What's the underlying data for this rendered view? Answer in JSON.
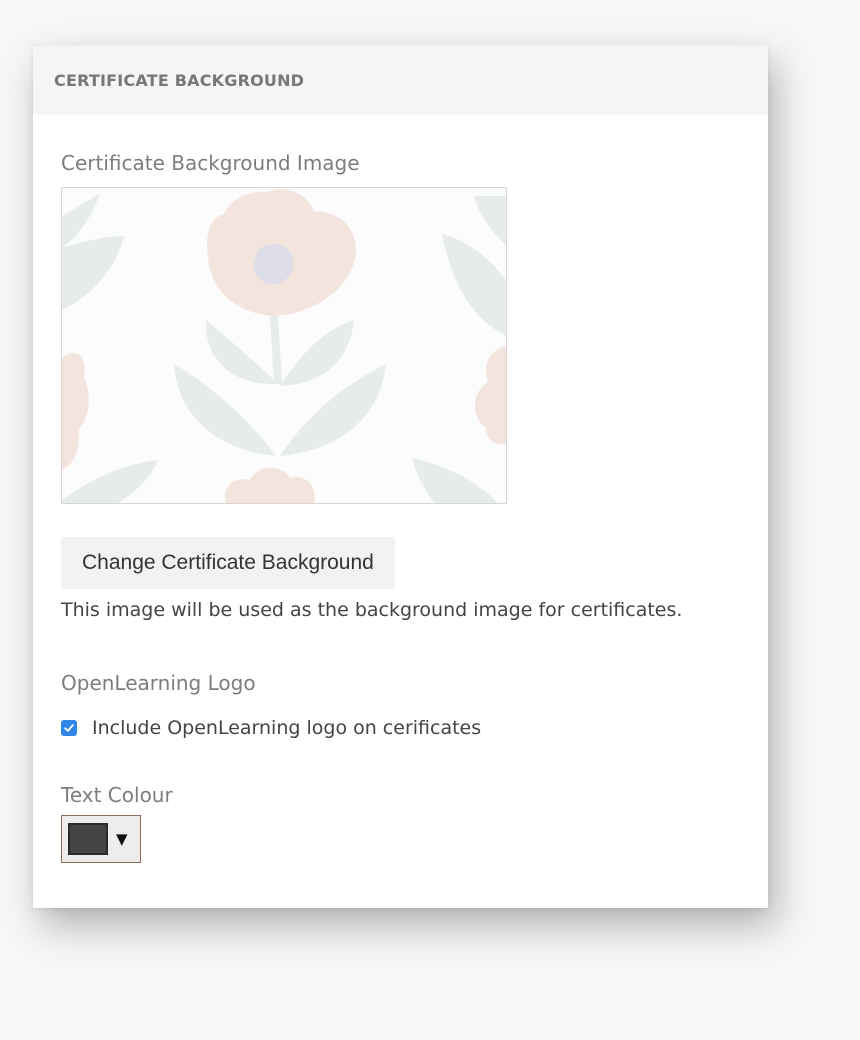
{
  "panel": {
    "title": "CERTIFICATE BACKGROUND"
  },
  "background": {
    "label": "Certificate Background Image",
    "change_button_label": "Change Certificate Background",
    "help_text": "This image will be used as the background image for certificates."
  },
  "logo": {
    "label": "OpenLearning Logo",
    "checkbox_label": "Include OpenLearning logo on cerificates",
    "checked": true
  },
  "text_colour": {
    "label": "Text Colour",
    "value": "#444444",
    "arrow_glyph": "▼"
  },
  "colors": {
    "checkbox_accent": "#2f86e6",
    "petal": "#f3e4de",
    "leaf": "#e6ecea",
    "centre": "#dcdde6"
  }
}
